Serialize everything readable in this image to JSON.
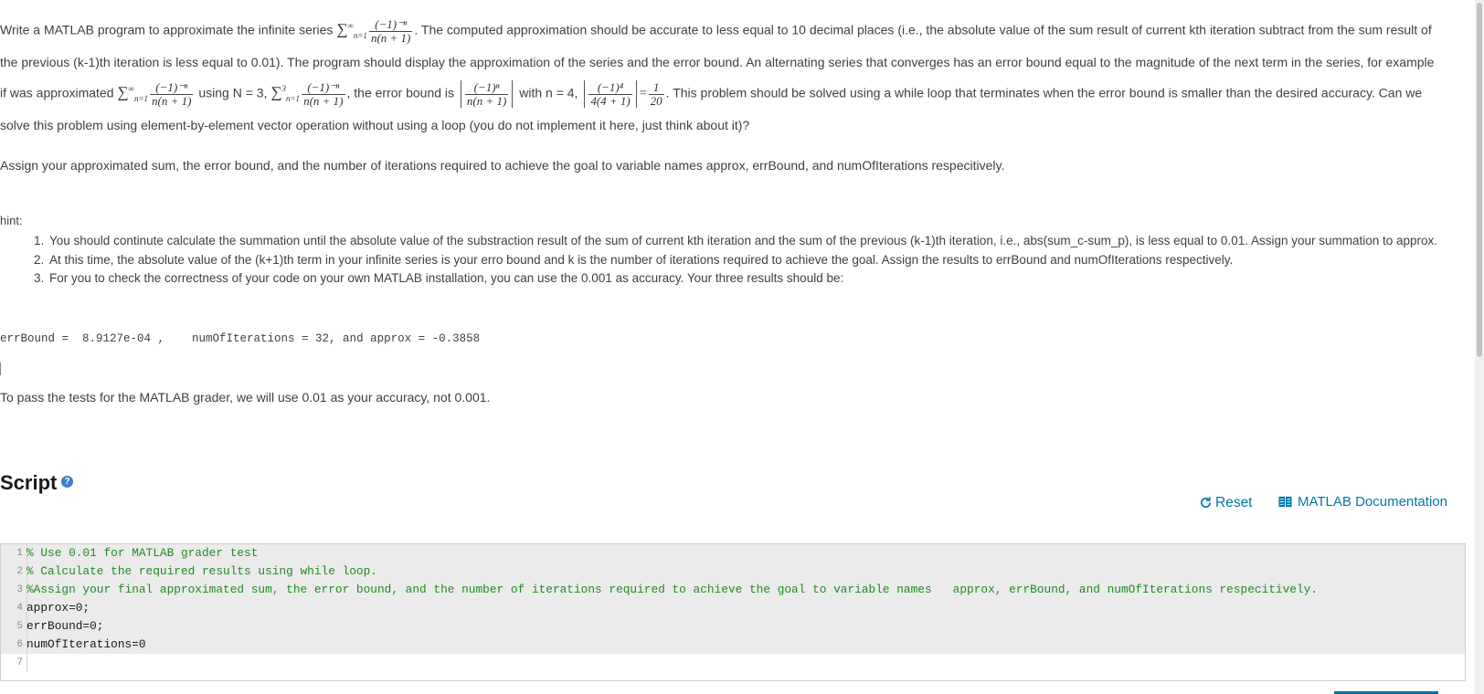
{
  "problem": {
    "intro_1": "Write a MATLAB program to approximate the infinite series",
    "intro_2": ". The computed approximation should be accurate to less equal to 10 decimal places (i.e., the absolute value of the sum result of current kth iteration subtract from the sum result of the previous (k-1)th iteration is less equal to 0.01). The program should display the approximation of the series and the error bound. An alternating series that converges has an error bound equal to the magnitude of the next term in the series, for example if  was approximated",
    "intro_3": "using N = 3,",
    "intro_4": ", the error bound is",
    "intro_5": "with n  = 4,",
    "intro_6": ". This problem should be solved using a while loop that terminates when the error bound is smaller than the desired accuracy. Can we solve this problem using element-by-element vector operation without using a loop (you do not implement it here, just think about it)?",
    "assign": "Assign your approximated sum, the error bound, and the number of iterations required to achieve the goal to variable names   approx, errBound, and numOfIterations respecitively.",
    "hint_label": "hint:",
    "hints": [
      "You should continute calculate the summation until the absolute value of the substraction result of the sum of current kth iteration and the sum of the previous (k-1)th iteration, i.e., abs(sum_c-sum_p), is less equal to 0.01. Assign your summation to approx.",
      "At this time, the absolute value of the (k+1)th term in your infinite series is your erro bound and k is the number of iterations required to achieve the goal.   Assign the results to errBound and numOfIterations respectively.",
      "For you to check the correctness of your code on your own MATLAB installation, you can use the 0.001 as accuracy. Your three results should be:"
    ],
    "expected": "errBound =  8.9127e-04 ,    numOfIterations = 32, and approx = -0.3858",
    "pass_note": "To pass the tests for the MATLAB grader, we will use 0.01 as your accuracy, not 0.001."
  },
  "math": {
    "sum_sym": "∑",
    "sup_inf": "∞",
    "sup_3": "3",
    "sub_n1": "n=1",
    "num_neg_n": "(−1)⁻ⁿ",
    "num_n": "(−1)ⁿ",
    "num_4": "(−1)⁴",
    "den_n": "n(n + 1)",
    "den_4": "4(4 + 1)",
    "eq": "=",
    "one": "1",
    "twenty": "20"
  },
  "script": {
    "title": "Script",
    "help_icon": "?",
    "reset_label": "Reset",
    "doc_label": "MATLAB Documentation",
    "lines": [
      {
        "n": "1",
        "text": "% Use 0.01 for MATLAB grader test"
      },
      {
        "n": "2",
        "text": "% Calculate the required results using while loop."
      },
      {
        "n": "3",
        "text": "%Assign your final approximated sum, the error bound, and the number of iterations required to achieve the goal to variable names   approx, errBound, and numOfIterations respecitively."
      },
      {
        "n": "4",
        "text": "approx=0;"
      },
      {
        "n": "5",
        "text": "errBound=0;"
      },
      {
        "n": "6",
        "text": "numOfIterations=0"
      },
      {
        "n": "7",
        "text": ""
      }
    ]
  },
  "colors": {
    "link": "#0076a8",
    "comment": "#228b22",
    "help_icon_bg": "#3f7ec6"
  }
}
